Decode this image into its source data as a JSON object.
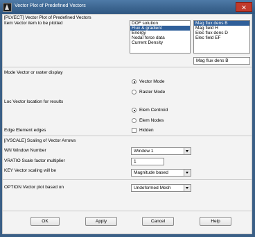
{
  "window": {
    "title": "Vector Plot of Predefined Vectors",
    "close_label": "✕"
  },
  "header": {
    "command": "[PLVECT]  Vector Plot of Predefined Vectors"
  },
  "item": {
    "label": "Item   Vector item to be plotted",
    "categories": [
      "DOF solution",
      "Flux & gradient",
      "Energy",
      "Nodal force data",
      "Current Density"
    ],
    "selected_category": "Flux & gradient",
    "components": [
      "Mag flux dens  B",
      "Mag field      H",
      "Elec flux dens D",
      "Elec field    EF"
    ],
    "selected_component": "Mag flux dens  B",
    "selection_display": "Mag flux dens  B"
  },
  "mode": {
    "label": "Mode   Vector or raster display",
    "options": [
      "Vector Mode",
      "Raster Mode"
    ],
    "selected": "Vector Mode"
  },
  "loc": {
    "label": "Loc   Vector location for results",
    "options": [
      "Elem Centroid",
      "Elem Nodes"
    ],
    "selected": "Elem Centroid"
  },
  "edge": {
    "label": "Edge Element edges",
    "checkbox_label": "Hidden",
    "checked": false
  },
  "vscale": {
    "header": "[/VSCALE] Scaling of Vector Arrows",
    "wn_label": "WN   Window Number",
    "wn_value": "Window 1",
    "vratio_label": "VRATIO  Scale factor multiplier",
    "vratio_value": "1",
    "key_label": "KEY     Vector scaling will be",
    "key_value": "Magnitude based"
  },
  "option": {
    "label": "OPTION  Vector plot based on",
    "value": "Undeformed Mesh"
  },
  "buttons": {
    "ok": "OK",
    "apply": "Apply",
    "cancel": "Cancel",
    "help": "Help"
  }
}
